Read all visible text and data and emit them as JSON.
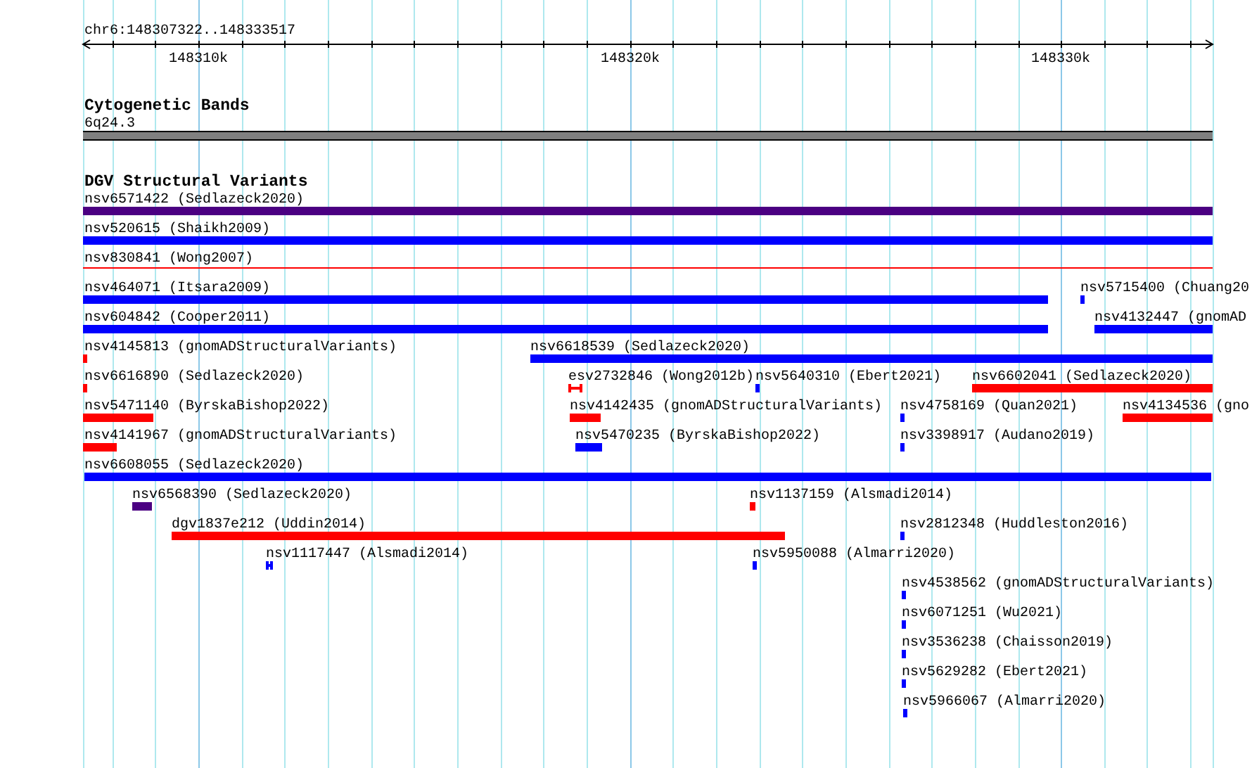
{
  "ruler": {
    "location": "chr6:148307322..148333517",
    "ticks": [
      "148310k",
      "148320k",
      "148330k"
    ]
  },
  "tracks": [
    {
      "kind": "bands",
      "title": "Cytogenetic Bands",
      "items": [
        {
          "label": "6q24.3"
        }
      ]
    },
    {
      "kind": "variants",
      "title": "DGV Structural Variants",
      "items": [
        {
          "label": "nsv6571422 (Sedlazeck2020)",
          "color": "#4b0082",
          "kind": "bar"
        },
        {
          "label": "nsv520615 (Shaikh2009)",
          "color": "#0000ff",
          "kind": "bar"
        },
        {
          "label": "nsv830841 (Wong2007)",
          "color": "#ff0000",
          "kind": "line"
        },
        {
          "label": "nsv464071 (Itsara2009)",
          "color": "#0000ff",
          "kind": "bar"
        },
        {
          "label": "nsv5715400 (Chuang20",
          "color": "#0000ff",
          "kind": "bar"
        },
        {
          "label": "nsv604842 (Cooper2011)",
          "color": "#0000ff",
          "kind": "bar"
        },
        {
          "label": "nsv4132447 (gnomAD",
          "color": "#0000ff",
          "kind": "bar"
        },
        {
          "label": "nsv4145813 (gnomADStructuralVariants)",
          "color": "#ff0000",
          "kind": "bar"
        },
        {
          "label": "nsv6618539 (Sedlazeck2020)",
          "color": "#0000ff",
          "kind": "bar"
        },
        {
          "label": "nsv6616890 (Sedlazeck2020)",
          "color": "#ff0000",
          "kind": "bar"
        },
        {
          "label": "esv2732846 (Wong2012b)",
          "color": "#ff0000",
          "kind": "bracket"
        },
        {
          "label": "nsv5640310 (Ebert2021)",
          "color": "#0000ff",
          "kind": "bar"
        },
        {
          "label": "nsv6602041 (Sedlazeck2020)",
          "color": "#ff0000",
          "kind": "bar"
        },
        {
          "label": "nsv5471140 (ByrskaBishop2022)",
          "color": "#ff0000",
          "kind": "bar"
        },
        {
          "label": "nsv4142435 (gnomADStructuralVariants)",
          "color": "#ff0000",
          "kind": "bar"
        },
        {
          "label": "nsv4758169 (Quan2021)",
          "color": "#0000ff",
          "kind": "bar"
        },
        {
          "label": "nsv4134536 (gno",
          "color": "#ff0000",
          "kind": "bar"
        },
        {
          "label": "nsv4141967 (gnomADStructuralVariants)",
          "color": "#ff0000",
          "kind": "bar"
        },
        {
          "label": "nsv5470235 (ByrskaBishop2022)",
          "color": "#0000ff",
          "kind": "bar"
        },
        {
          "label": "nsv3398917 (Audano2019)",
          "color": "#0000ff",
          "kind": "bar"
        },
        {
          "label": "nsv6608055 (Sedlazeck2020)",
          "color": "#0000ff",
          "kind": "bar"
        },
        {
          "label": "nsv6568390 (Sedlazeck2020)",
          "color": "#4b0082",
          "kind": "bar"
        },
        {
          "label": "nsv1137159 (Alsmadi2014)",
          "color": "#ff0000",
          "kind": "bar"
        },
        {
          "label": "dgv1837e212 (Uddin2014)",
          "color": "#ff0000",
          "kind": "bar"
        },
        {
          "label": "nsv2812348 (Huddleston2016)",
          "color": "#0000ff",
          "kind": "bar"
        },
        {
          "label": "nsv1117447 (Alsmadi2014)",
          "color": "#0000ff",
          "kind": "bracket"
        },
        {
          "label": "nsv5950088 (Almarri2020)",
          "color": "#0000ff",
          "kind": "bar"
        },
        {
          "label": "nsv4538562 (gnomADStructuralVariants)",
          "color": "#0000ff",
          "kind": "bar"
        },
        {
          "label": "nsv6071251 (Wu2021)",
          "color": "#0000ff",
          "kind": "bar"
        },
        {
          "label": "nsv3536238 (Chaisson2019)",
          "color": "#0000ff",
          "kind": "bar"
        },
        {
          "label": "nsv5629282 (Ebert2021)",
          "color": "#0000ff",
          "kind": "bar"
        },
        {
          "label": "nsv5966067 (Almarri2020)",
          "color": "#0000ff",
          "kind": "bar"
        }
      ]
    }
  ]
}
